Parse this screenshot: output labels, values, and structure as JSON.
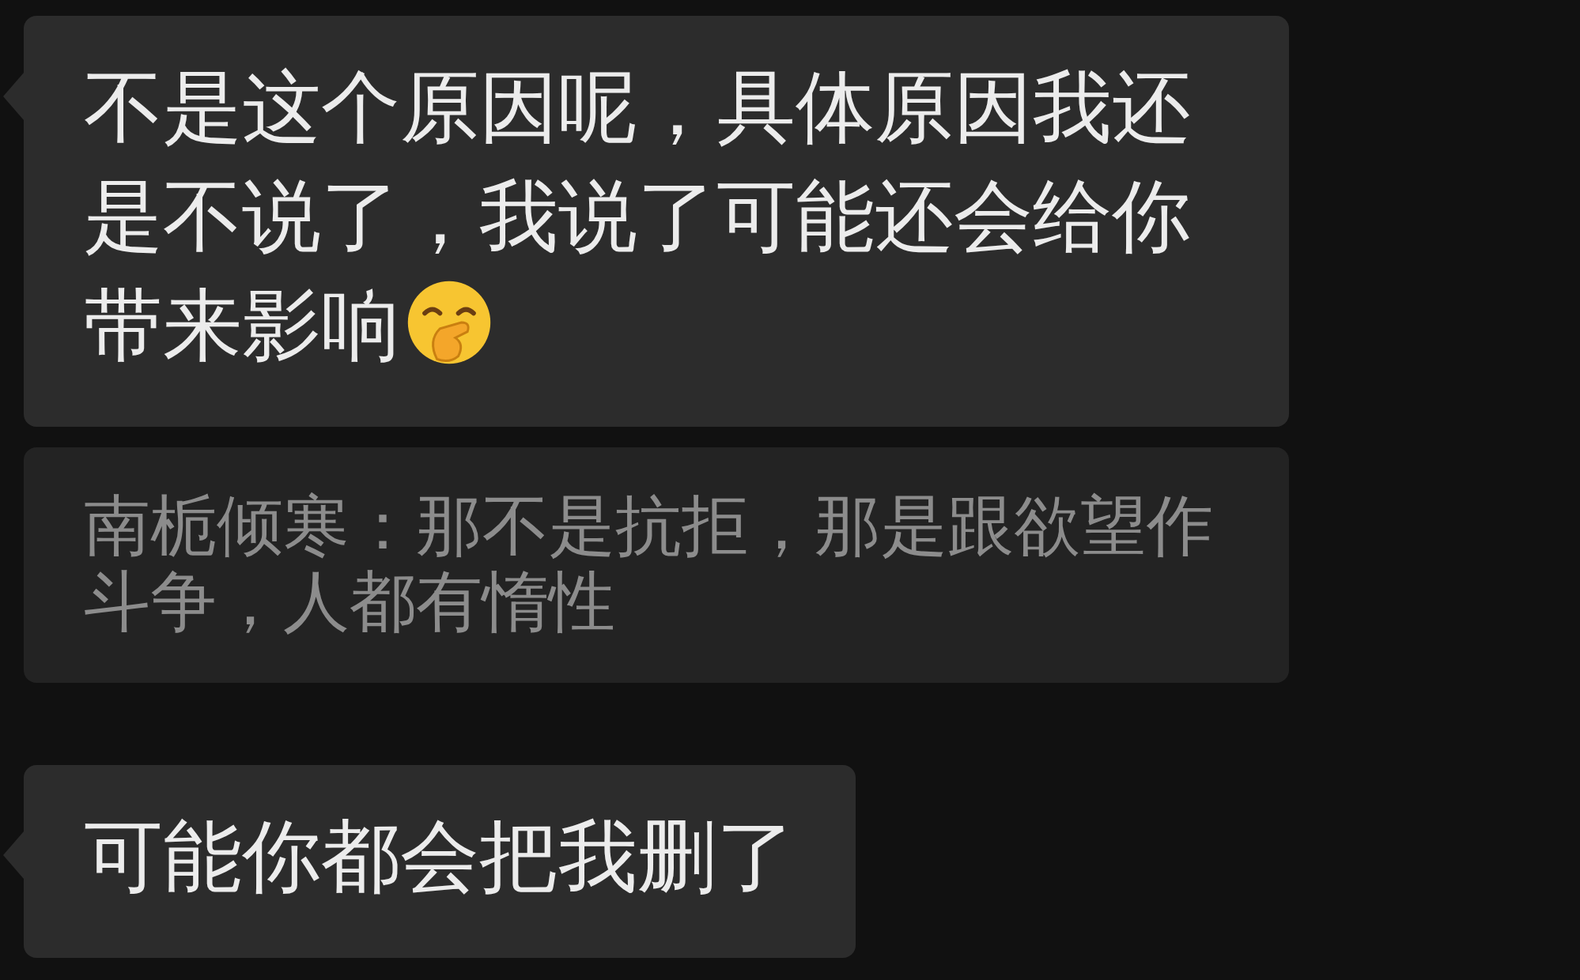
{
  "messages": [
    {
      "kind": "bubble",
      "text": "不是这个原因呢，具体原因我还是不说了，我说了可能还会给你带来影响",
      "trailing_emoji": true
    },
    {
      "kind": "quote",
      "text": "南栀倾寒：那不是抗拒，那是跟欲望作斗争，人都有惰性"
    },
    {
      "kind": "bubble",
      "text": "可能你都会把我删了",
      "trailing_emoji": false
    }
  ]
}
